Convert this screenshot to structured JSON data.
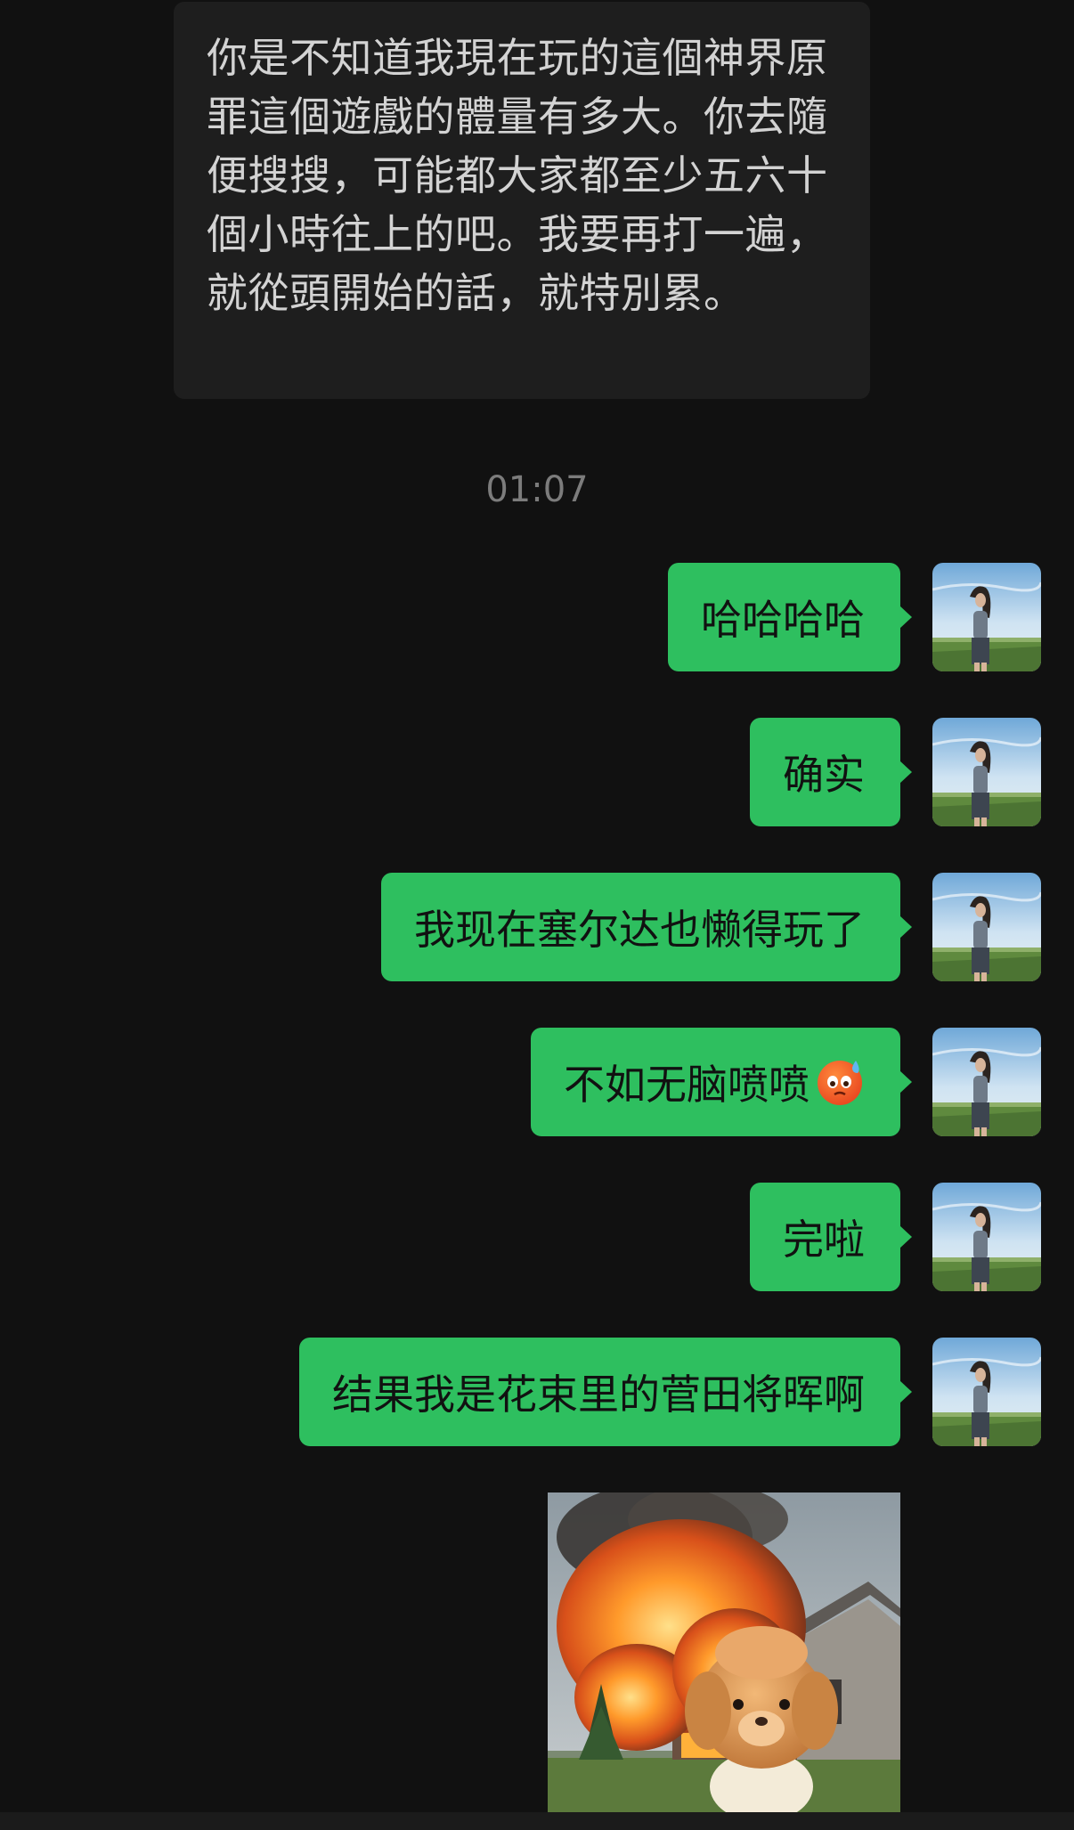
{
  "received_message": {
    "text": "你是不知道我現在玩的這個神界原罪這個遊戲的體量有多大。你去隨便搜搜，可能都大家都至少五六十個小時往上的吧。我要再打一遍，就從頭開始的話，就特別累。"
  },
  "timestamp": "01:07",
  "sent_messages": [
    {
      "text": "哈哈哈哈"
    },
    {
      "text": "确实"
    },
    {
      "text": "我现在塞尔达也懒得玩了"
    },
    {
      "text": "不如无脑喷喷",
      "emoji": "hot-sweat-face-icon"
    },
    {
      "text": "完啦"
    },
    {
      "text": "结果我是花束里的菅田将晖啊"
    }
  ],
  "sticker": {
    "type": "image",
    "icon": "burning-house-teddy-sticker"
  },
  "colors": {
    "background": "#111111",
    "received_bubble": "#1e1e1e",
    "sent_bubble": "#2ebf5f",
    "timestamp": "#7c7c7c"
  }
}
